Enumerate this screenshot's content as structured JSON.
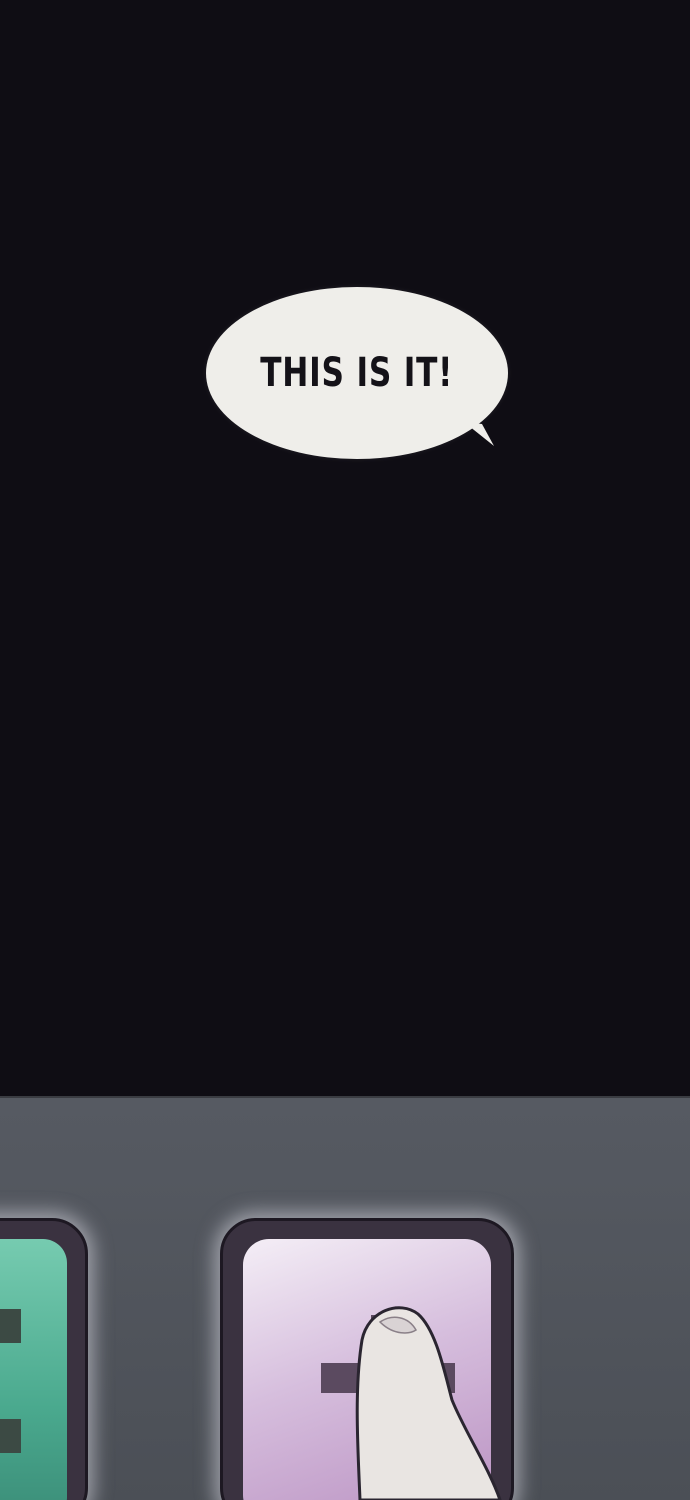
{
  "speech_bubble": {
    "text": "THIS IS IT!"
  },
  "keypad": {
    "left_key": {
      "icon": "equals-icon",
      "color": "#5bb99c"
    },
    "right_key": {
      "icon": "plus-icon",
      "color": "#cfb3d6"
    }
  },
  "colors": {
    "night_background": "#0f0d14",
    "bubble": "#efeeea",
    "panel": "#4f535a"
  }
}
